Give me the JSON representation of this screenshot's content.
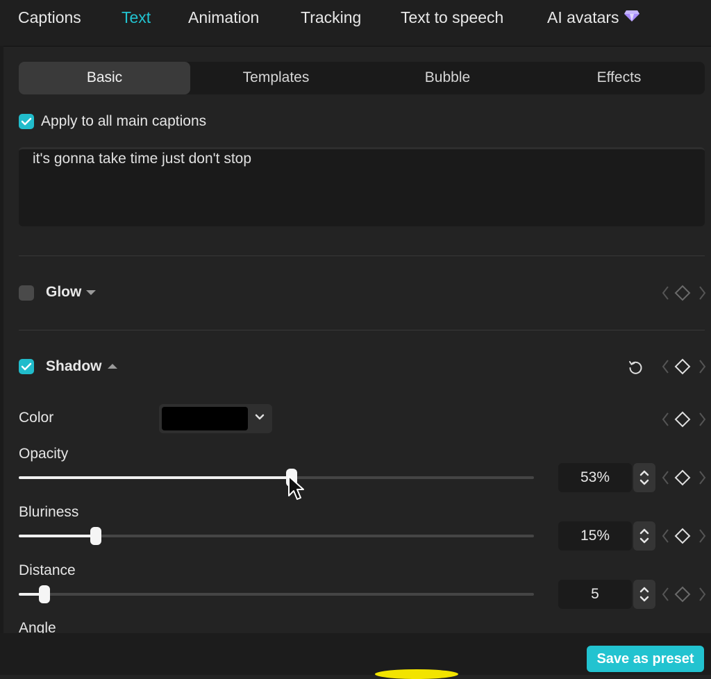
{
  "top_tabs": [
    {
      "label": "Captions"
    },
    {
      "label": "Text"
    },
    {
      "label": "Animation"
    },
    {
      "label": "Tracking"
    },
    {
      "label": "Text to speech"
    },
    {
      "label": "AI avatars",
      "icon": "diamond-premium-icon"
    }
  ],
  "active_top_tab": "Text",
  "sub_tabs": [
    {
      "label": "Basic"
    },
    {
      "label": "Templates"
    },
    {
      "label": "Bubble"
    },
    {
      "label": "Effects"
    }
  ],
  "active_sub_tab": "Basic",
  "apply_all": {
    "label": "Apply to all main captions",
    "checked": true
  },
  "caption_text": "it's gonna take time just don't stop",
  "glow": {
    "label": "Glow",
    "enabled": false
  },
  "shadow": {
    "label": "Shadow",
    "enabled": true,
    "color": {
      "label": "Color",
      "value": "#000000"
    },
    "opacity": {
      "label": "Opacity",
      "value": "53%",
      "level": 0.53
    },
    "bluriness": {
      "label": "Bluriness",
      "value": "15%",
      "level": 0.15
    },
    "distance": {
      "label": "Distance",
      "value": "5",
      "level": 0.05
    },
    "angle": {
      "label": "Angle"
    }
  },
  "save_preset": {
    "label": "Save as preset"
  },
  "colors": {
    "accent": "#22c3d0",
    "background": "#232323"
  }
}
